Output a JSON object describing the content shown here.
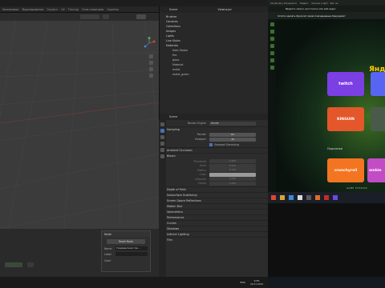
{
  "viewport": {
    "menu": [
      "Компоновка",
      "Моделирование",
      "Скульпт",
      "UV",
      "Текстур",
      "Узлы геометрии",
      "Скрипты"
    ],
    "options_label": "Options"
  },
  "outliner": {
    "title": "Scene",
    "view_layer": "ViewLayer",
    "items": [
      "Brushes",
      "Cameras",
      "Collections",
      "Images",
      "Lights",
      "Line Styles",
      "Materials"
    ],
    "materials": [
      "Dots Stroke",
      "fire",
      "glass",
      "Material",
      "metal",
      "metal_green"
    ]
  },
  "properties": {
    "scene_name": "Scene",
    "render_engine_label": "Render Engine",
    "render_engine_value": "EEVEE",
    "sampling": {
      "header": "Sampling",
      "render_label": "Render",
      "render_value": "64",
      "viewport_label": "Viewport",
      "viewport_value": "16",
      "denoise_label": "Viewport Denoising"
    },
    "sections": [
      "Ambient Occlusion",
      "Bloom"
    ],
    "bloom_rows": [
      "Threshold",
      "Knee",
      "Radius",
      "Color",
      "Intensity",
      "Clamp"
    ],
    "bloom_values": [
      "0.800",
      "0.500",
      "6.500",
      "",
      "0.050",
      "0.000"
    ],
    "more_sections": [
      "Depth of Field",
      "Subsurface Scattering",
      "Screen Space Reflections",
      "Motion Blur",
      "Volumetrics",
      "Performance",
      "Curves",
      "Shadows",
      "Indirect Lighting",
      "Film"
    ]
  },
  "node_panel": {
    "header": "Node",
    "reset_label": "Reset Node",
    "name_label": "Name",
    "name_value": "Градиентная тек...",
    "label_label": "Label",
    "color_label": "Color"
  },
  "browser": {
    "tabs": [
      "Yandex.Ru | Личный ка",
      "Яндекс",
      "Король и Шут - Бег на"
    ],
    "banner": "Хотите сделать Opera GX своим повседневным браузером?",
    "search_hint": "Введите запрос для поиска или веб-адрес",
    "brand": "Янд",
    "speed_dial": [
      "twitch",
      "KINGUIN",
      "crunchyroll",
      "ambie"
    ],
    "subscribe_label": "Подсказки",
    "footer_brand": "GAME STUDIOS"
  },
  "statusbar": {
    "time": "9:56",
    "date": "24.01.2024",
    "lang": "ENG"
  },
  "colors": {
    "accent_green": "#7ed957",
    "twitch": "#7b3fe4",
    "kinguin": "#e3572a",
    "crunchyroll": "#f47521",
    "ambie": "#c24cc6",
    "blender_blue": "#4772b3"
  }
}
